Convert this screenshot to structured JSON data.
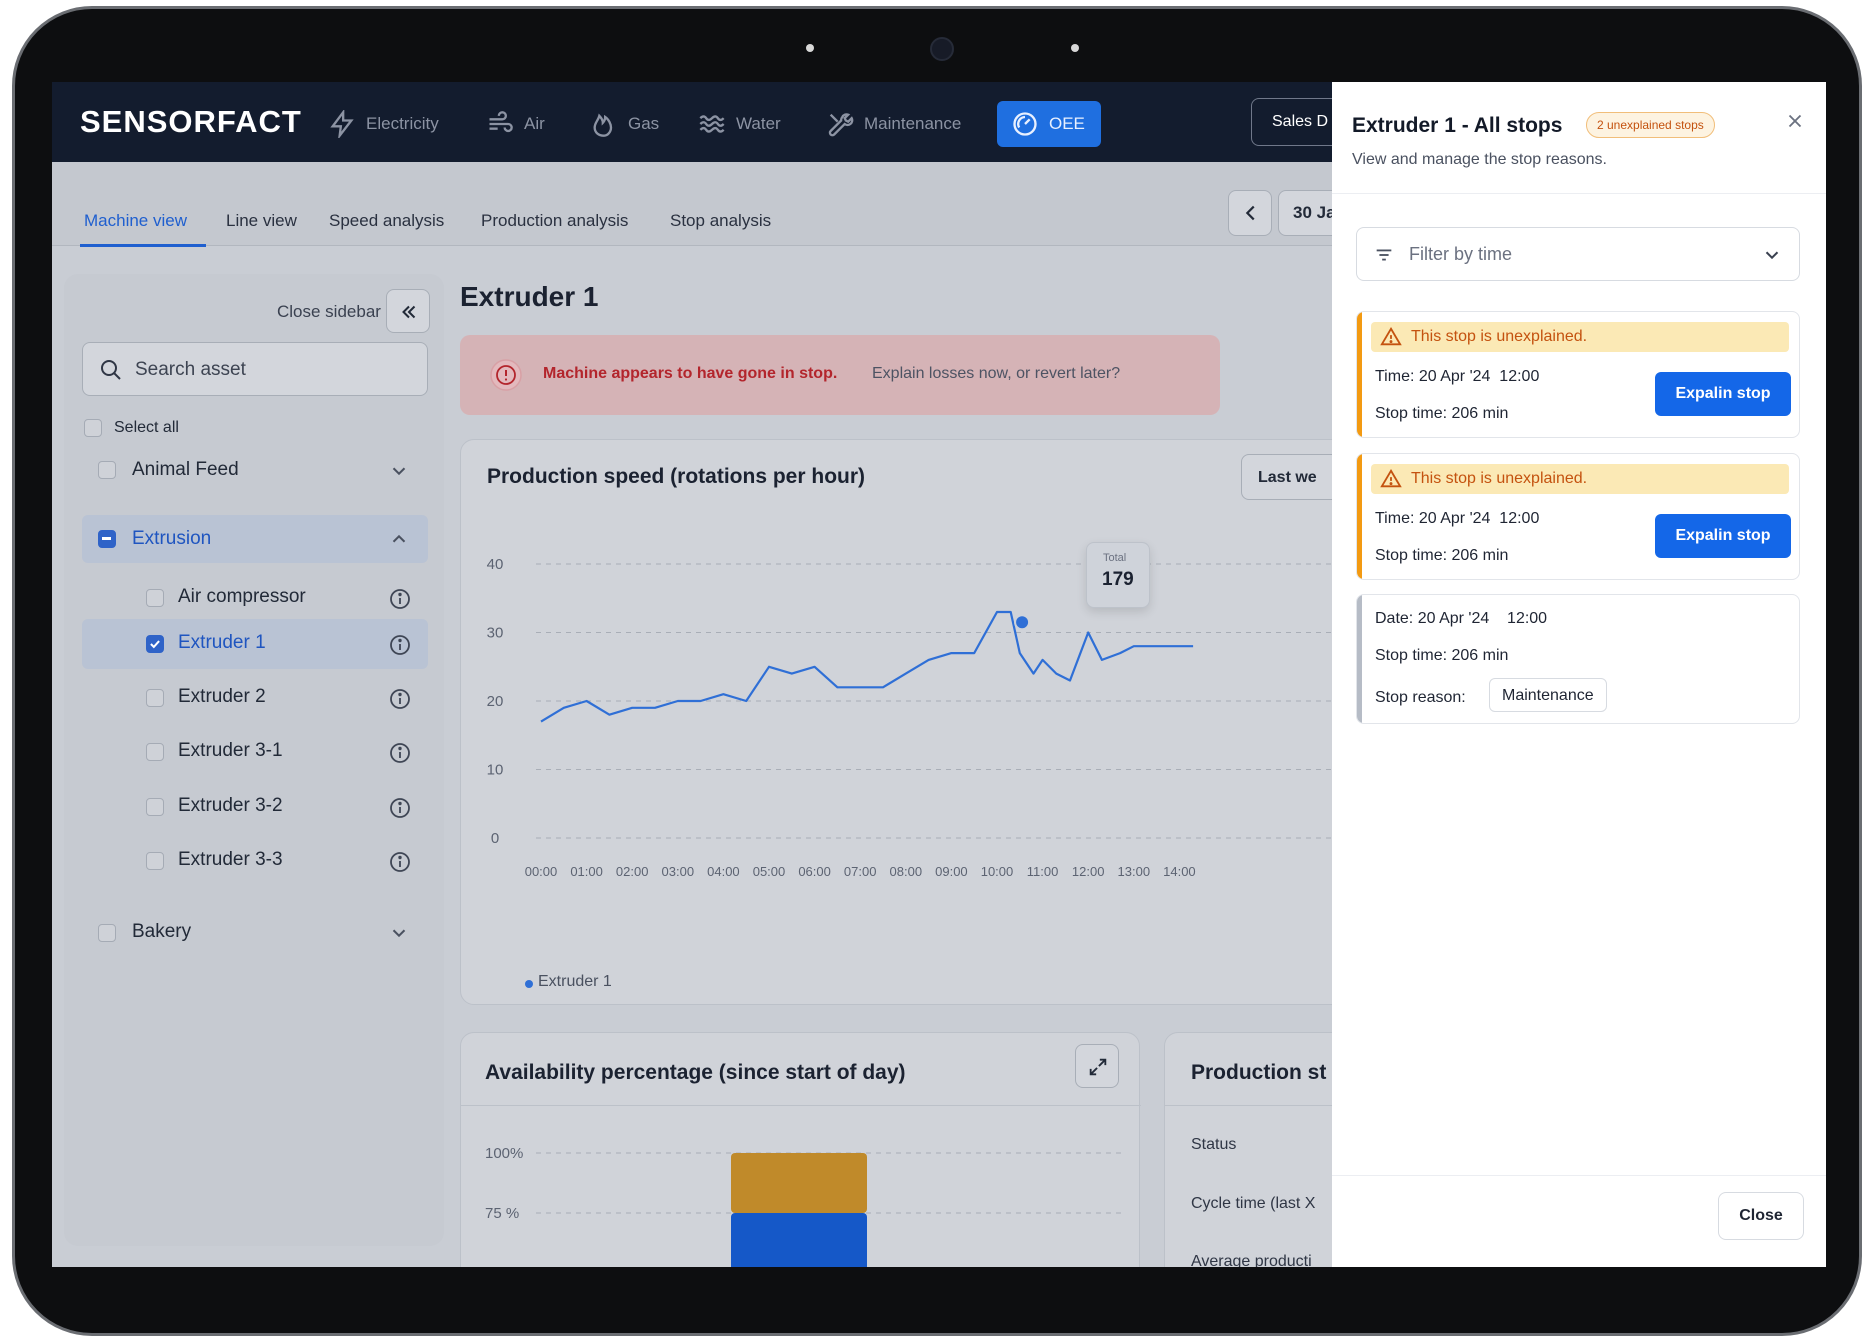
{
  "app": {
    "brand": "SENSORFACT"
  },
  "topnav": {
    "items": [
      {
        "label": "Electricity",
        "icon": "lightning-icon"
      },
      {
        "label": "Air",
        "icon": "wind-icon"
      },
      {
        "label": "Gas",
        "icon": "flame-icon"
      },
      {
        "label": "Water",
        "icon": "water-waves-icon"
      },
      {
        "label": "Maintenance",
        "icon": "wrench-icon"
      },
      {
        "label": "OEE",
        "icon": "gauge-icon",
        "active": true
      }
    ],
    "sales_button": "Sales D"
  },
  "subnav": {
    "tabs": [
      "Machine view",
      "Line view",
      "Speed analysis",
      "Production analysis",
      "Stop analysis"
    ],
    "active_tab": "Machine view",
    "date_label": "30 Ja"
  },
  "sidebar": {
    "close_label": "Close sidebar",
    "search_placeholder": "Search asset",
    "select_all": "Select all",
    "groups": [
      {
        "label": "Animal Feed",
        "expanded": false
      },
      {
        "label": "Extrusion",
        "expanded": true
      },
      {
        "label": "Bakery",
        "expanded": false
      }
    ],
    "assets": [
      "Air compressor",
      "Extruder 1",
      "Extruder 2",
      "Extruder 3-1",
      "Extruder 3-2",
      "Extruder 3-3"
    ],
    "selected_asset": "Extruder 1"
  },
  "main": {
    "title": "Extruder 1",
    "banner": {
      "strong": "Machine appears to have gone in stop.",
      "text": "Explain losses now, or revert later?"
    },
    "speed_card": {
      "title": "Production speed (rotations per hour)",
      "range_button": "Last we",
      "tooltip_label": "Total",
      "tooltip_value": "179",
      "legend": "Extruder 1"
    },
    "availability_card": {
      "title": "Availability percentage (since start of day)",
      "y_ticks": [
        "100%",
        "75 %"
      ]
    },
    "production_card": {
      "title": "Production st",
      "rows": [
        "Status",
        "Cycle time (last X",
        "Average producti"
      ]
    }
  },
  "chart_data": [
    {
      "type": "line",
      "title": "Production speed (rotations per hour)",
      "xlabel": "",
      "ylabel": "",
      "ylim": [
        0,
        40
      ],
      "y_ticks": [
        0,
        10,
        20,
        30,
        40
      ],
      "x_ticks": [
        "00:00",
        "01:00",
        "02:00",
        "03:00",
        "04:00",
        "05:00",
        "06:00",
        "07:00",
        "08:00",
        "09:00",
        "10:00",
        "11:00",
        "12:00",
        "13:00",
        "14:00"
      ],
      "grid": true,
      "legend": "bottom-left",
      "series": [
        {
          "name": "Extruder 1",
          "color": "#2f6fd6",
          "x": [
            0,
            0.5,
            1,
            1.5,
            2,
            2.5,
            3,
            3.5,
            4,
            4.5,
            5,
            5.5,
            6,
            6.5,
            7,
            7.5,
            8,
            8.5,
            9,
            9.5,
            10,
            10.3,
            10.5,
            10.8,
            11,
            11.3,
            11.6,
            12,
            12.3,
            12.7,
            13,
            13.4,
            13.7,
            14.0,
            14.3
          ],
          "values": [
            17,
            19,
            20,
            18,
            19,
            19,
            20,
            20,
            21,
            20,
            25,
            24,
            25,
            22,
            22,
            22,
            24,
            26,
            27,
            27,
            33,
            33,
            27,
            24,
            26,
            24,
            23,
            30,
            26,
            27,
            28,
            28,
            28,
            28,
            28
          ]
        }
      ],
      "tooltip": {
        "label": "Total",
        "value": 179,
        "x": 10.55
      }
    },
    {
      "type": "bar",
      "title": "Availability percentage (since start of day)",
      "ylim": [
        0,
        100
      ],
      "y_ticks": [
        "100%",
        "75 %"
      ],
      "series": [
        {
          "name": "",
          "color": "#c08a2a",
          "values": [
            25
          ]
        },
        {
          "name": "",
          "color": "#1558c8",
          "values": [
            75
          ]
        }
      ]
    }
  ],
  "panel": {
    "title": "Extruder 1 - All stops",
    "badge": "2 unexplained stops",
    "subtitle": "View and manage the stop reasons.",
    "filter_placeholder": "Filter by time",
    "cards": [
      {
        "warning": "This stop is unexplained.",
        "time_label": "Time:",
        "time": "20 Apr '24  12:00",
        "stop_label": "Stop time:",
        "stop_time": "206 min",
        "button": "Expalin stop"
      },
      {
        "warning": "This stop is unexplained.",
        "time_label": "Time:",
        "time": "20 Apr '24  12:00",
        "stop_label": "Stop time:",
        "stop_time": "206 min",
        "button": "Expalin stop"
      },
      {
        "date_label": "Date:",
        "date": "20 Apr '24    12:00",
        "stop_label": "Stop time:",
        "stop_time": "206 min",
        "reason_label": "Stop reason:",
        "reason": "Maintenance"
      }
    ],
    "close_button": "Close"
  },
  "colors": {
    "nav_bg": "#131c2e",
    "accent": "#1467e8",
    "warning_stripe": "#f39a12",
    "warning_bg": "#fbe9b5",
    "alert_text": "#b3252c"
  }
}
